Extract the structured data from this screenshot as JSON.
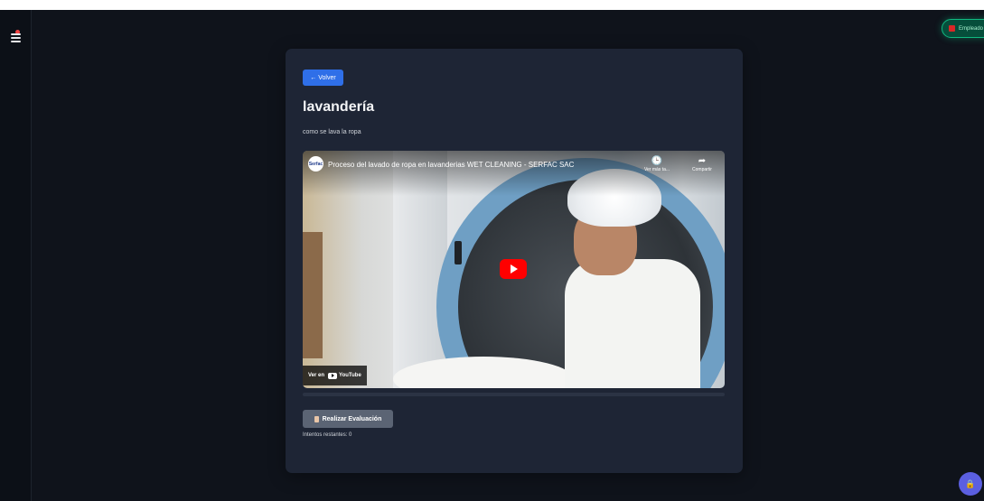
{
  "header": {
    "user_label": "Empleado",
    "user_icon": "user-badge-icon",
    "accent": "#10b981"
  },
  "sidebar": {
    "menu_icon": "menu-icon"
  },
  "lesson": {
    "back_label": "← Volver",
    "title": "lavandería",
    "description": "como se lava la ropa",
    "video": {
      "channel_logo": "Serfac",
      "title": "Proceso del lavado de ropa en lavanderias WET CLEANING - SERFAC SAC",
      "watch_later_label": "Ver más ta...",
      "share_label": "Compartir",
      "watch_on": "Ver en",
      "platform": "YouTube"
    },
    "evaluation_button": "Realizar Evaluación",
    "attempts_text": "Intentos restantes: 0"
  },
  "fab": {
    "icon": "lock-icon",
    "color": "#5b5fe0"
  }
}
